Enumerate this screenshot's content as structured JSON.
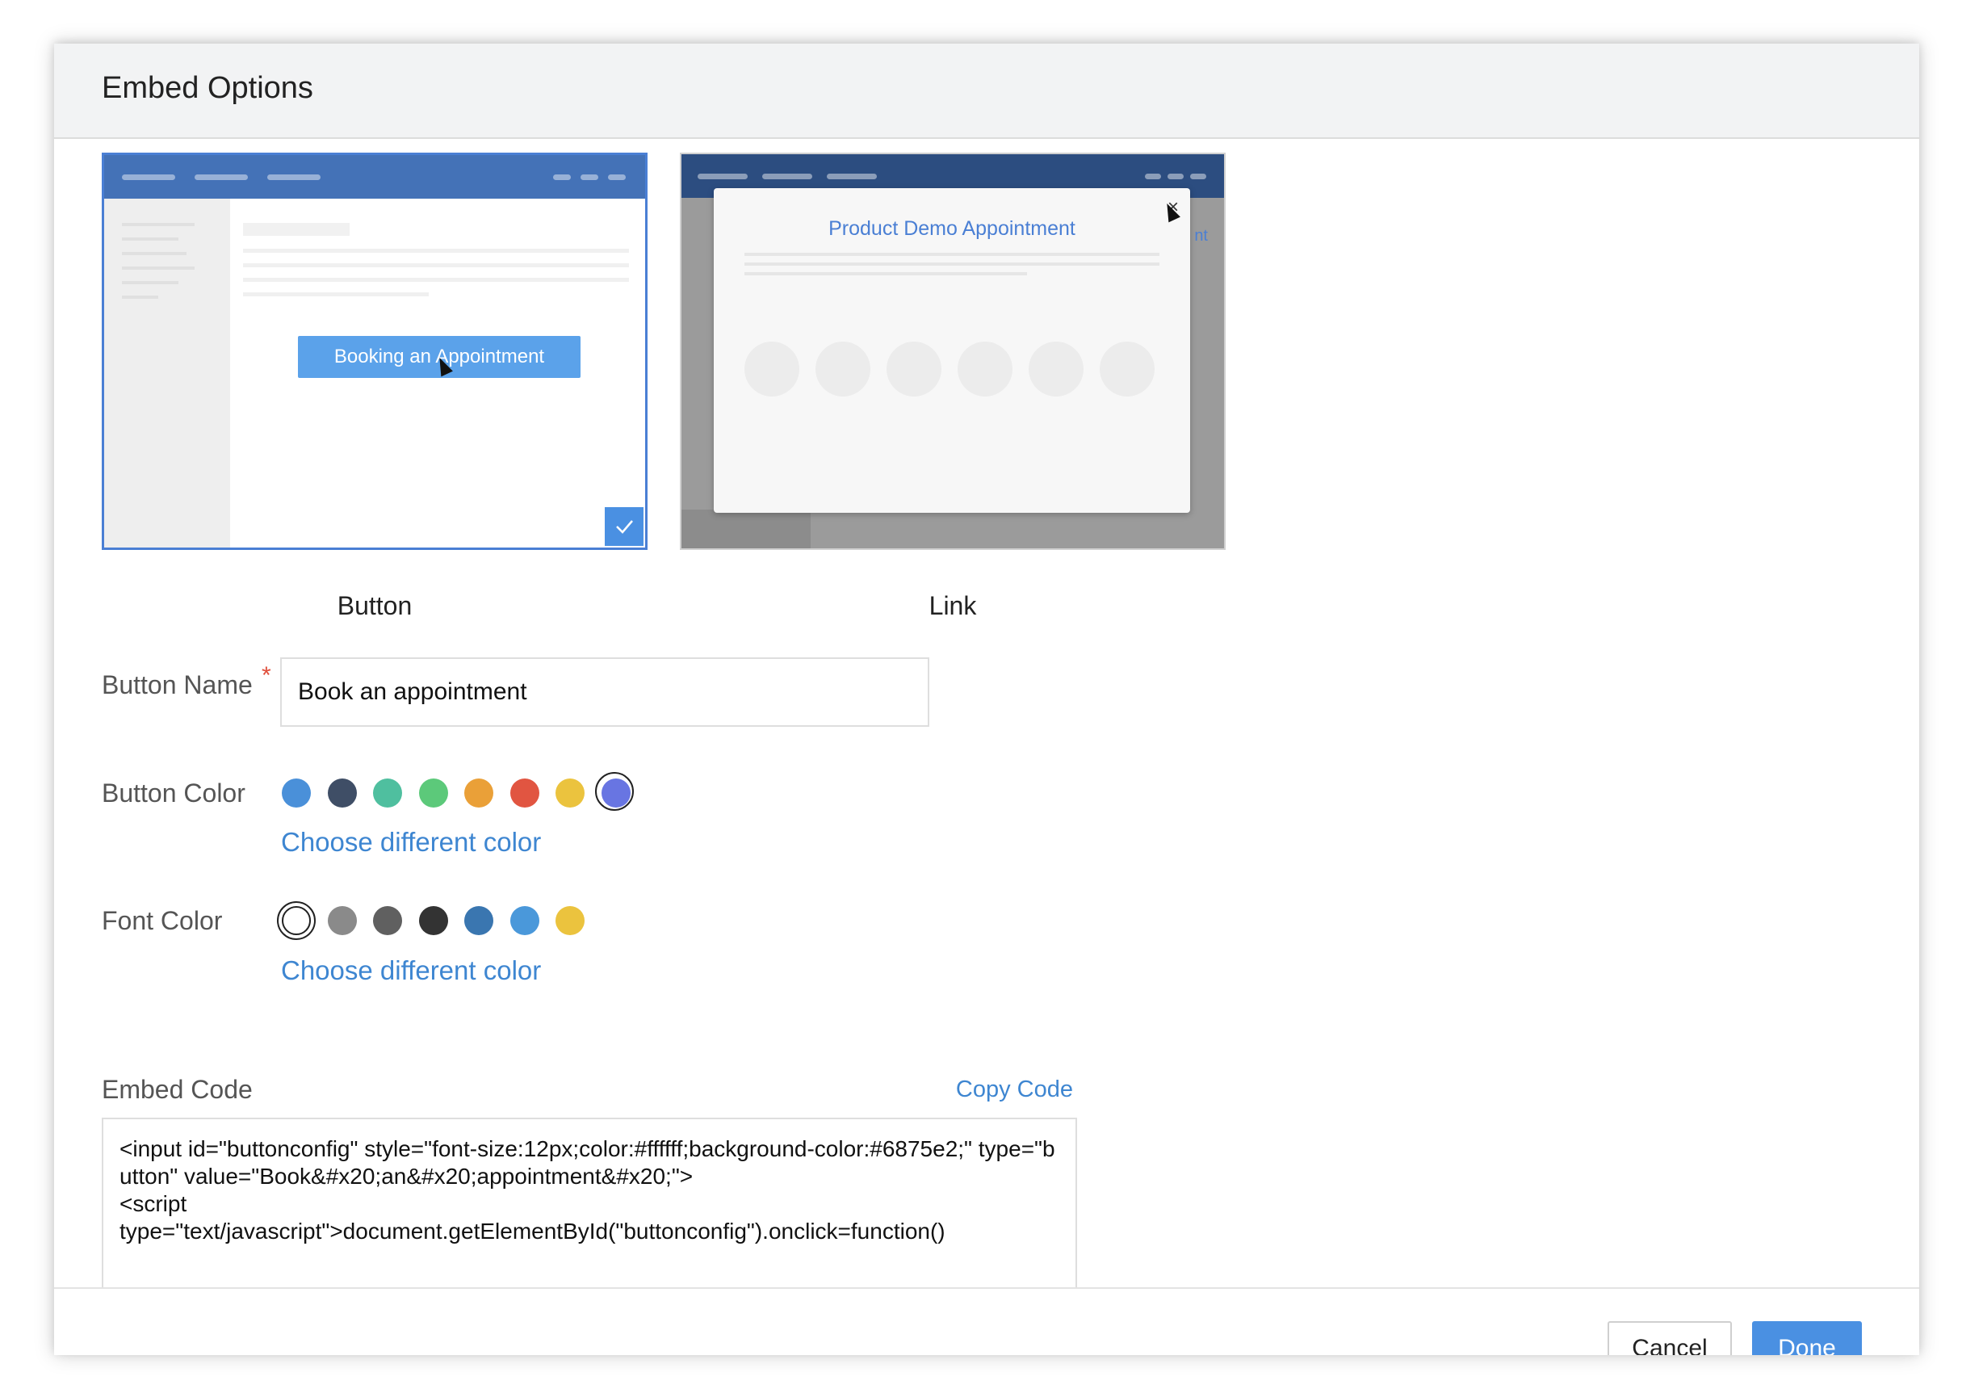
{
  "modal": {
    "title": "Embed Options"
  },
  "previews": {
    "button": {
      "caption": "Button",
      "sample_button_label": "Booking an Appointment",
      "selected": true
    },
    "link": {
      "caption": "Link",
      "popup_title": "Product Demo Appointment",
      "close_glyph": "×",
      "partial_text": "nt"
    }
  },
  "form": {
    "button_name": {
      "label": "Button Name",
      "required_mark": "*",
      "value": "Book an appointment"
    },
    "button_color": {
      "label": "Button Color",
      "link": "Choose different color",
      "swatches": [
        "#4a90d9",
        "#3f4e66",
        "#4fbf9f",
        "#5cc97a",
        "#eaa038",
        "#e15541",
        "#ebc33e",
        "#6875e2"
      ],
      "selected_index": 7
    },
    "font_color": {
      "label": "Font Color",
      "link": "Choose different color",
      "swatches": [
        "#ffffff",
        "#8a8a8a",
        "#606060",
        "#333333",
        "#3a76b0",
        "#4a98da",
        "#ebc33e"
      ],
      "selected_index": 0
    },
    "embed_code": {
      "label": "Embed Code",
      "copy_label": "Copy Code",
      "value": "<input id=\"buttonconfig\" style=\"font-size:12px;color:#ffffff;background-color:#6875e2;\" type=\"button\" value=\"Book&#x20;an&#x20;appointment&#x20;\">\n<script\ntype=\"text/javascript\">document.getElementById(\"buttonconfig\").onclick=function()"
    }
  },
  "footer": {
    "cancel_label": "Cancel",
    "done_label": "Done"
  },
  "colors": {
    "accent": "#4a90e2",
    "link": "#3e86d1",
    "required": "#e04e3b"
  }
}
